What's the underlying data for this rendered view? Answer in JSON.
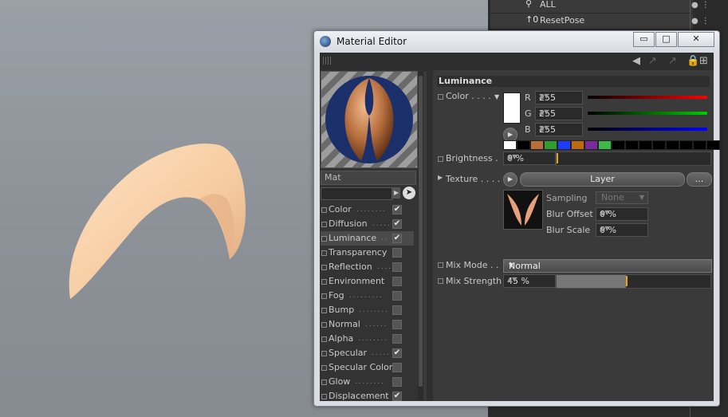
{
  "window": {
    "title": "Material Editor",
    "min": "▭",
    "max": "□",
    "close": "✕"
  },
  "objects": [
    {
      "name": "ALL",
      "icon": "bone-icon"
    },
    {
      "name": "ResetPose",
      "icon": "pose-icon"
    }
  ],
  "material": {
    "name": "Mat"
  },
  "channels": [
    {
      "label": "Color",
      "dots": ". . . . . . . .",
      "checked": true
    },
    {
      "label": "Diffusion",
      "dots": ". . . . .",
      "checked": true
    },
    {
      "label": "Luminance",
      "dots": ". .",
      "checked": true,
      "active": true
    },
    {
      "label": "Transparency",
      "dots": "",
      "checked": false
    },
    {
      "label": "Reflection",
      "dots": ". . . .",
      "checked": false
    },
    {
      "label": "Environment",
      "dots": "",
      "checked": false
    },
    {
      "label": "Fog",
      "dots": ". . . . . . . . .",
      "checked": false
    },
    {
      "label": "Bump",
      "dots": ". . . . . . . .",
      "checked": false
    },
    {
      "label": "Normal",
      "dots": ". . . . . .",
      "checked": false
    },
    {
      "label": "Alpha",
      "dots": ". . . . . . . .",
      "checked": false
    },
    {
      "label": "Specular",
      "dots": ". . . . .",
      "checked": true
    },
    {
      "label": "Specular Color",
      "dots": "",
      "checked": false
    },
    {
      "label": "Glow",
      "dots": ". . . . . . . .",
      "checked": false
    },
    {
      "label": "Displacement",
      "dots": "",
      "checked": true
    }
  ],
  "check_glyph": "✔",
  "luminance": {
    "header": "Luminance",
    "color_label": "Color . . . .",
    "r_label": "R",
    "g_label": "G",
    "b_label": "B",
    "r": "255",
    "g": "255",
    "b": "255",
    "brightness_label": "Brightness .",
    "brightness": "0 %",
    "brightness_fraction": 0.0,
    "texture_label": "Texture . . . .",
    "texture_button": "Layer",
    "texture_more": "...",
    "sampling_label": "Sampling",
    "sampling_value": "None",
    "blur_offset_label": "Blur Offset",
    "blur_offset": "0 %",
    "blur_scale_label": "Blur Scale",
    "blur_scale": "0 %",
    "mix_mode_label": "Mix Mode . .",
    "mix_mode": "Normal",
    "mix_strength_label": "Mix Strength",
    "mix_strength": "45 %",
    "mix_strength_fraction": 0.45
  },
  "swatch_colors": [
    "#ffffff",
    "#000000",
    "#b8703a",
    "#2f9e2f",
    "#1a3cff",
    "#c06a10",
    "#7a2a9a",
    "#3fb84a",
    "#000000",
    "#000000",
    "#000000",
    "#000000",
    "#000000",
    "#000000",
    "#000000",
    "#000000"
  ]
}
